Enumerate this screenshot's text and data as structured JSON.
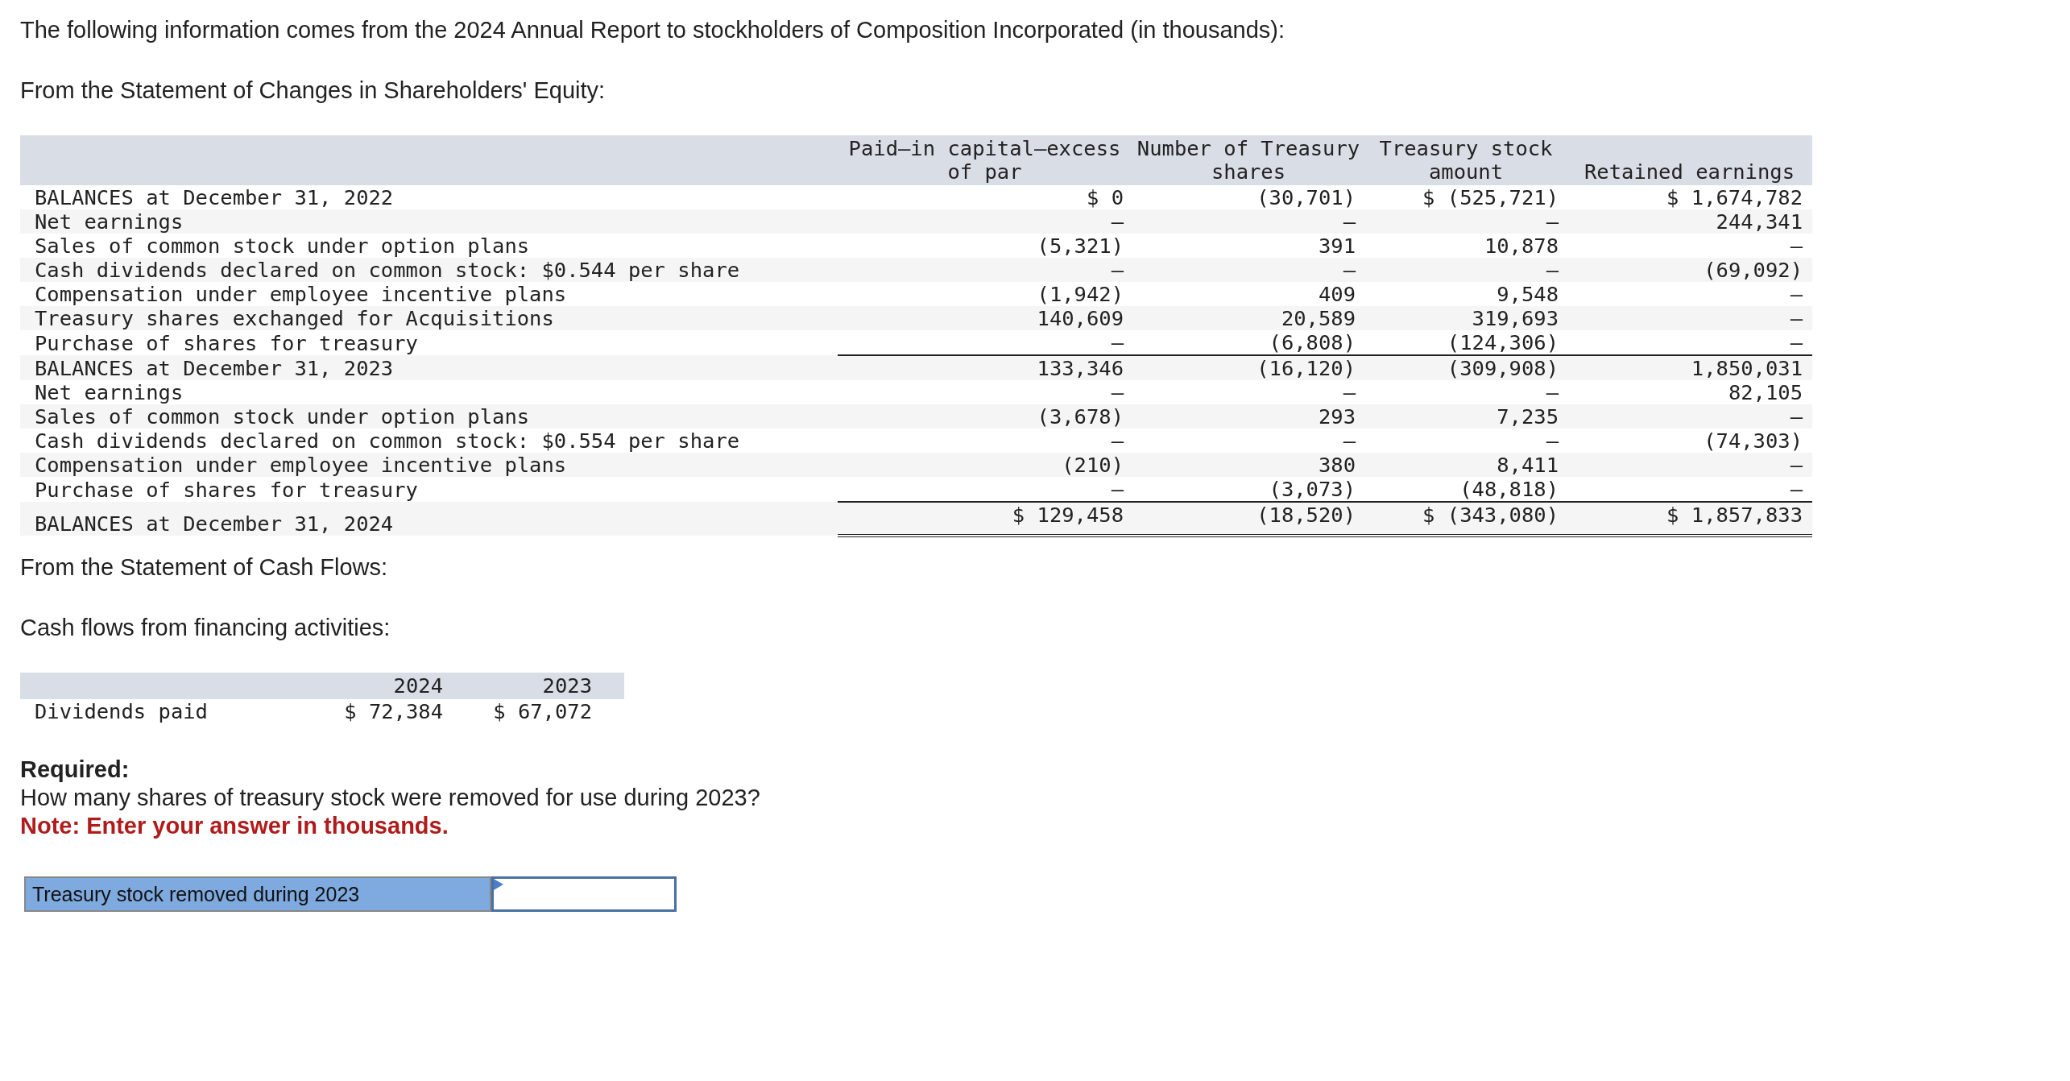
{
  "intro": "The following information comes from the 2024 Annual Report to stockholders of Composition Incorporated (in thousands):",
  "equity_heading": "From the Statement of Changes in Shareholders' Equity:",
  "equity_table": {
    "columns": [
      "Paid–in capital—excess of par",
      "Number of Treasury shares",
      "Treasury stock amount",
      "Retained earnings"
    ],
    "rows": [
      {
        "kind": "normal",
        "label": "BALANCES at December 31, 2022",
        "values": [
          "$ 0",
          "(30,701)",
          "$ (525,721)",
          "$ 1,674,782"
        ]
      },
      {
        "kind": "normal",
        "label": "Net earnings",
        "values": [
          "–",
          "–",
          "–",
          "244,341"
        ]
      },
      {
        "kind": "normal",
        "label": "Sales of common stock under option plans",
        "values": [
          "(5,321)",
          "391",
          "10,878",
          "–"
        ]
      },
      {
        "kind": "normal",
        "label": "Cash dividends declared on common stock: $0.544 per share",
        "values": [
          "–",
          "–",
          "–",
          "(69,092)"
        ]
      },
      {
        "kind": "normal",
        "label": "Compensation under employee incentive plans",
        "values": [
          "(1,942)",
          "409",
          "9,548",
          "–"
        ]
      },
      {
        "kind": "normal",
        "label": "Treasury shares exchanged for Acquisitions",
        "values": [
          "140,609",
          "20,589",
          "319,693",
          "–"
        ]
      },
      {
        "kind": "normal",
        "label": "Purchase of shares for treasury",
        "values": [
          "–",
          "(6,808)",
          "(124,306)",
          "–"
        ]
      },
      {
        "kind": "subtotal",
        "label": "BALANCES at December 31, 2023",
        "values": [
          "133,346",
          "(16,120)",
          "(309,908)",
          "1,850,031"
        ]
      },
      {
        "kind": "normal",
        "label": "Net earnings",
        "values": [
          "–",
          "–",
          "–",
          "82,105"
        ]
      },
      {
        "kind": "normal",
        "label": "Sales of common stock under option plans",
        "values": [
          "(3,678)",
          "293",
          "7,235",
          "–"
        ]
      },
      {
        "kind": "normal",
        "label": "Cash dividends declared on common stock: $0.554 per share",
        "values": [
          "–",
          "–",
          "–",
          "(74,303)"
        ]
      },
      {
        "kind": "normal",
        "label": "Compensation under employee incentive plans",
        "values": [
          "(210)",
          "380",
          "8,411",
          "–"
        ]
      },
      {
        "kind": "normal",
        "label": "Purchase of shares for treasury",
        "values": [
          "–",
          "(3,073)",
          "(48,818)",
          "–"
        ]
      },
      {
        "kind": "total",
        "label": "BALANCES at December 31, 2024",
        "values": [
          "$ 129,458",
          "(18,520)",
          "$ (343,080)",
          "$ 1,857,833"
        ]
      }
    ]
  },
  "cash_heading": "From the Statement of Cash Flows:",
  "cash_subheading": "Cash flows from financing activities:",
  "cash_table": {
    "columns": [
      "2024",
      "2023"
    ],
    "rows": [
      {
        "label": "Dividends paid",
        "values": [
          "$ 72,384",
          "$ 67,072"
        ]
      }
    ]
  },
  "required": {
    "title": "Required:",
    "question": "How many shares of treasury stock were removed for use during 2023?",
    "note": "Note: Enter your answer in thousands."
  },
  "answer": {
    "label": "Treasury stock removed during 2023"
  }
}
